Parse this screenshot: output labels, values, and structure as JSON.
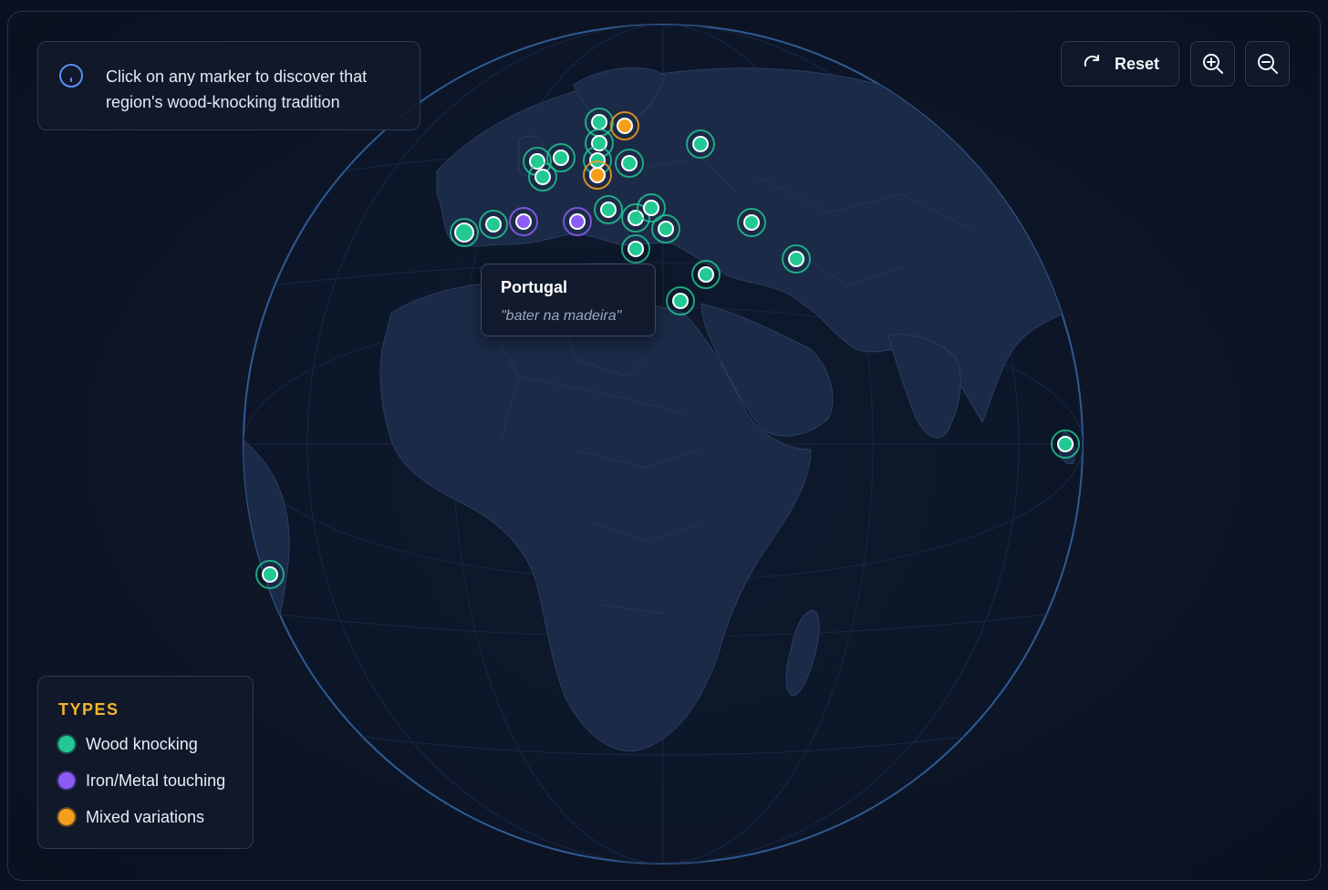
{
  "info": {
    "text": "Click on any marker to discover that region's wood-knocking tradition",
    "icon": "info-icon"
  },
  "controls": {
    "reset_label": "Reset",
    "reset_icon": "rotate-icon",
    "zoom_in_icon": "zoom-in-icon",
    "zoom_out_icon": "zoom-out-icon"
  },
  "tooltip": {
    "title": "Portugal",
    "phrase": "\"bater na madeira\""
  },
  "legend": {
    "title": "TYPES",
    "items": [
      {
        "label": "Wood knocking",
        "color": "#22c993"
      },
      {
        "label": "Iron/Metal touching",
        "color": "#8b5cf6"
      },
      {
        "label": "Mixed variations",
        "color": "#f59e1b"
      }
    ]
  },
  "colors": {
    "wood": "#22c993",
    "iron": "#8b5cf6",
    "mixed": "#f59e1b",
    "globe_stroke": "#2f5b93",
    "land": "#1b2a47"
  }
}
